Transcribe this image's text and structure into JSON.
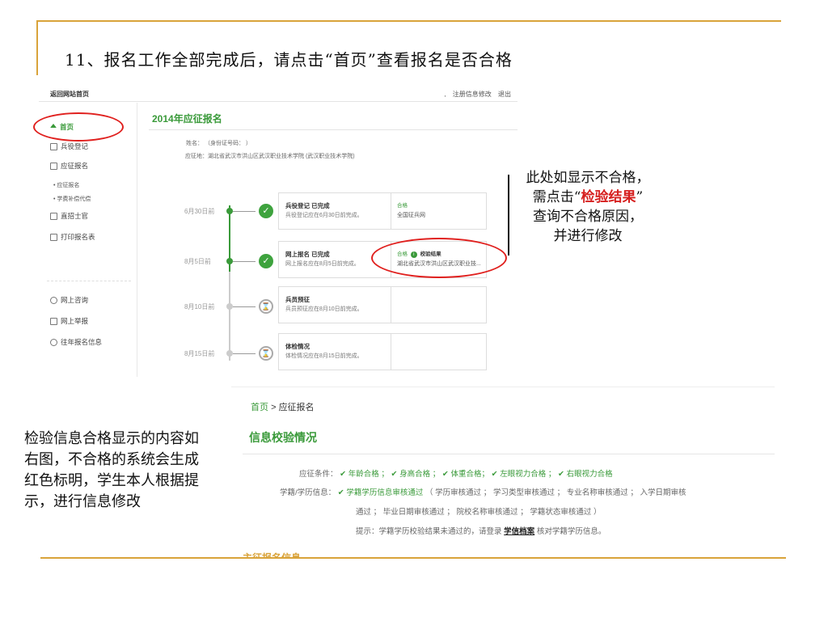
{
  "slide": {
    "title": "11、报名工作全部完成后，请点击“首页”查看报名是否合格",
    "annotation": {
      "line1": "此处如显示不合格，",
      "line2_pre": "需点击“",
      "line2_hl": "检验结果",
      "line2_post": "”",
      "line3": "查询不合格原因，",
      "line4": "并进行修改"
    },
    "note": "检验信息合格显示的内容如右图，不合格的系统会生成红色标明，学生本人根据提示，进行信息修改"
  },
  "shot1": {
    "back_link": "返回网站首页",
    "top_links": ",   注册信息修改   退出",
    "heading": "2014年应征报名",
    "info_name": "姓名：     （身份证号码：                           ）",
    "info_place": "应征地：湖北省武汉市洪山区武汉职业技术学院 (武汉职业技术学院)",
    "sidebar": [
      {
        "label": "首页",
        "icon": "home-icon"
      },
      {
        "label": "兵役登记",
        "icon": "document-icon"
      },
      {
        "label": "应征报名",
        "icon": "form-icon"
      },
      {
        "label": "• 应征报名",
        "sub": true
      },
      {
        "label": "• 学费补偿代偿",
        "sub": true
      },
      {
        "label": "直招士官",
        "icon": "card-icon"
      },
      {
        "label": "打印报名表",
        "icon": "printer-icon"
      },
      {
        "label": "网上咨询",
        "icon": "chat-icon"
      },
      {
        "label": "网上举报",
        "icon": "mail-icon"
      },
      {
        "label": "往年报名信息",
        "icon": "history-icon"
      }
    ],
    "timeline": [
      {
        "date": "6月30日前",
        "title": "兵役登记 已完成",
        "desc": "兵役登记应在6月30日前完成。",
        "status": "合格",
        "detail": "全国征兵网"
      },
      {
        "date": "8月5日前",
        "title": "网上报名 已完成",
        "desc": "网上报名应在8月5日前完成。",
        "status": "合格",
        "verify": "校验结果",
        "detail": "湖北省武汉市洪山区武汉职业技..."
      },
      {
        "date": "8月10日前",
        "title": "兵员预征",
        "desc": "兵员预征应在8月10日前完成。",
        "status": "",
        "detail": ""
      },
      {
        "date": "8月15日前",
        "title": "体检情况",
        "desc": "体检情况应在8月15日前完成。",
        "status": "",
        "detail": ""
      }
    ]
  },
  "shot2": {
    "breadcrumb_home": "首页",
    "breadcrumb_sep": ">",
    "breadcrumb_current": "应征报名",
    "title": "信息校验情况",
    "cond_label": "应征条件：",
    "cond_value": "✔ 年龄合格 ；   ✔ 身高合格 ；   ✔ 体重合格；  ✔ 左眼视力合格 ；   ✔ 右眼视力合格",
    "edu_label": "学籍/学历信息：",
    "edu_green": "✔ 学籍学历信息审核通过",
    "edu_rest": "（ 学历审核通过 ； 学习类型审核通过 ； 专业名称审核通过 ； 入学日期审核",
    "edu_line2": "通过 ； 毕业日期审核通过 ； 院校名称审核通过 ； 学籍状态审核通过 ）",
    "hint_pre": "提示：学籍学历校验结果未通过的，请登录",
    "hint_link": "学信档案",
    "hint_post": "核对学籍学历信息。",
    "cutoff": "主征报名信息"
  }
}
